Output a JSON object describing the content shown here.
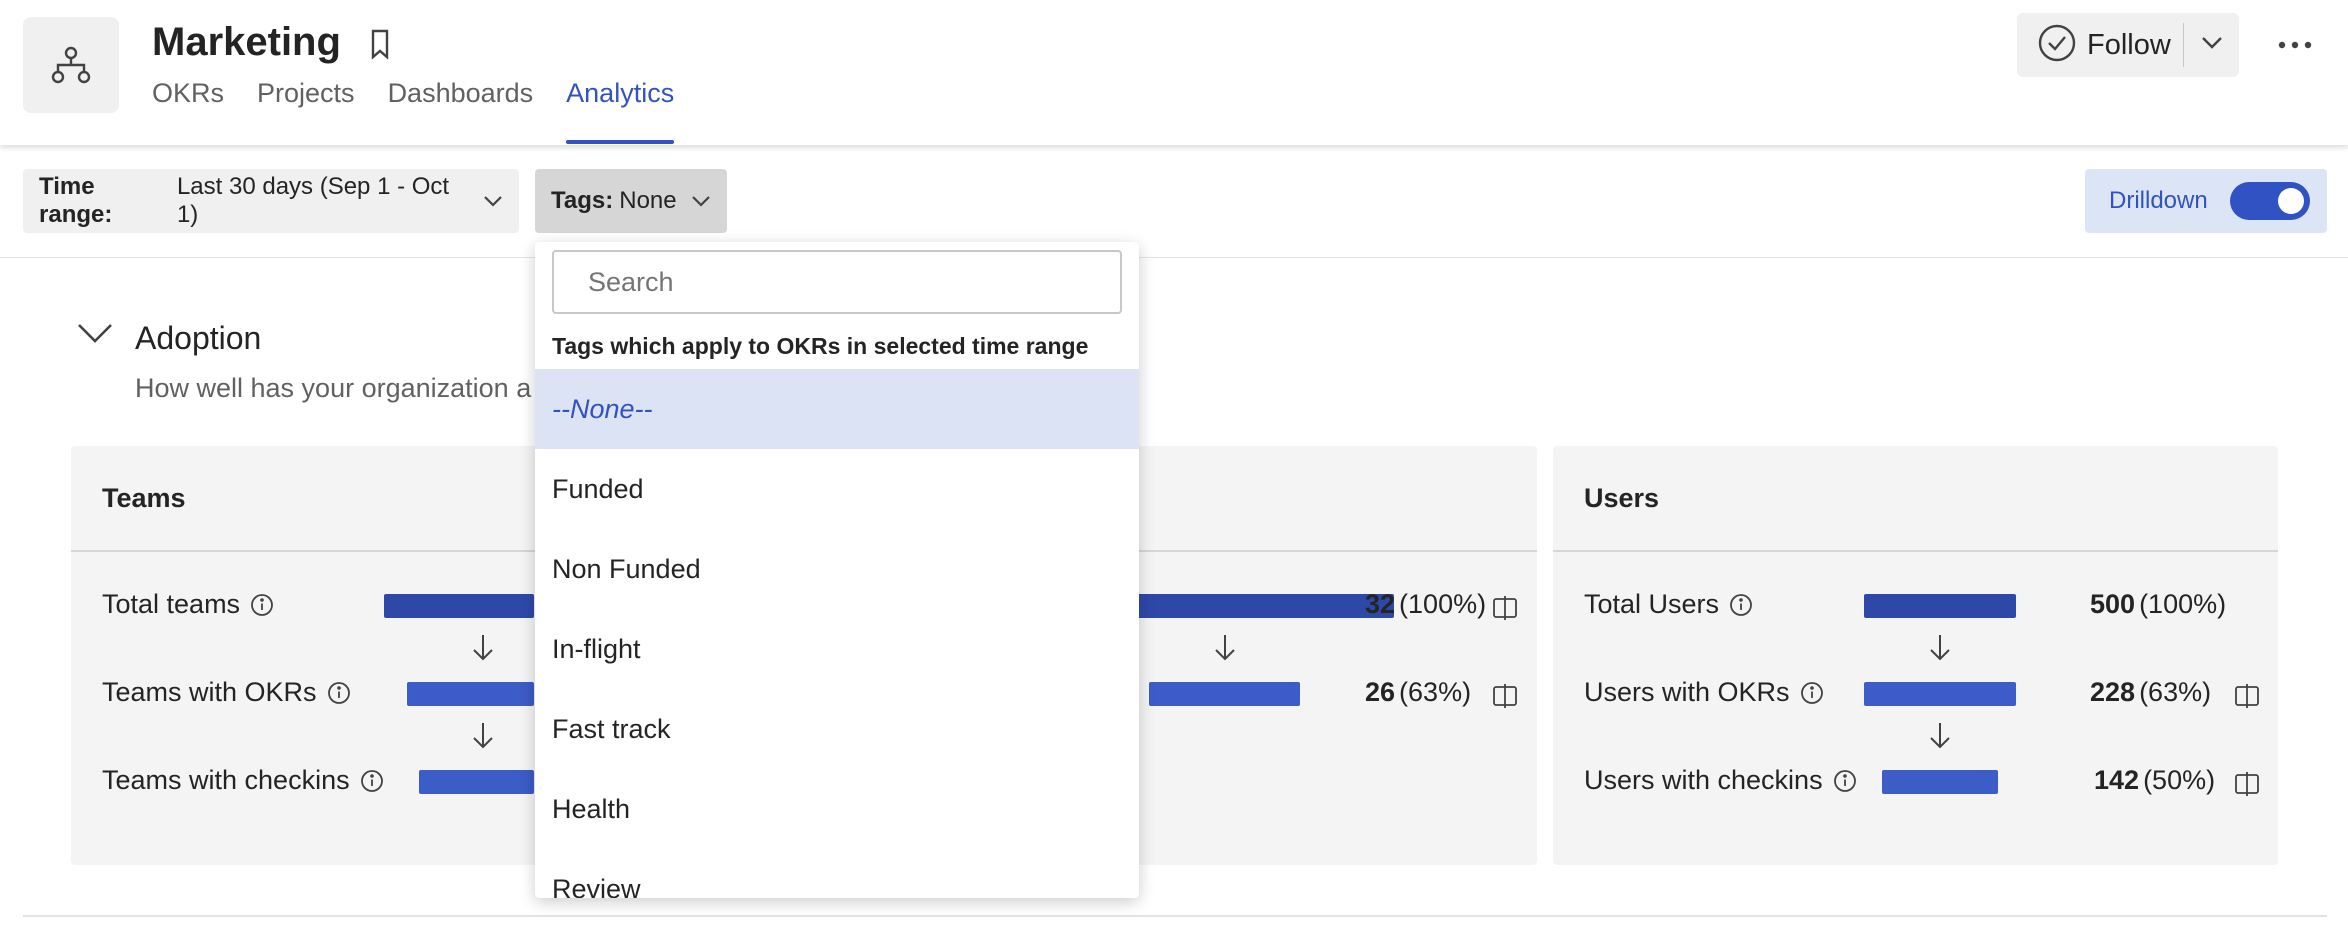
{
  "header": {
    "title": "Marketing",
    "tabs": [
      {
        "label": "OKRs",
        "active": false
      },
      {
        "label": "Projects",
        "active": false
      },
      {
        "label": "Dashboards",
        "active": false
      },
      {
        "label": "Analytics",
        "active": true
      }
    ],
    "follow_label": "Follow",
    "accent_color": "#3152c2"
  },
  "filters": {
    "time_range_key": "Time range:",
    "time_range_value": "Last 30 days (Sep 1 - Oct 1)",
    "tags_key": "Tags:",
    "tags_value": "None",
    "drilldown_label": "Drilldown",
    "drilldown_on": true
  },
  "section": {
    "title": "Adoption",
    "description": "How well has your organization a"
  },
  "teams_card": {
    "title": "Teams",
    "rows": [
      {
        "label": "Total teams",
        "count": "32",
        "pct": "(100%)"
      },
      {
        "label": "Teams with OKRs",
        "count": "26",
        "pct": "(63%)"
      },
      {
        "label": "Teams with checkins"
      }
    ]
  },
  "users_card": {
    "title": "Users",
    "rows": [
      {
        "label": "Total Users",
        "count": "500",
        "pct": "(100%)"
      },
      {
        "label": "Users with OKRs",
        "count": "228",
        "pct": "(63%)"
      },
      {
        "label": "Users with checkins",
        "count": "142",
        "pct": "(50%)"
      }
    ]
  },
  "tags_dropdown": {
    "search_placeholder": "Search",
    "hint": "Tags which apply to OKRs in selected time range",
    "items": [
      "--None--",
      "Funded",
      "Non Funded",
      "In-flight",
      "Fast track",
      "Health",
      "Review"
    ],
    "selected": "--None--"
  }
}
